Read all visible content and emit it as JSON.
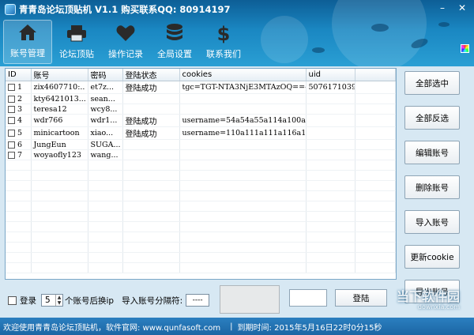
{
  "window": {
    "title": "青青岛论坛顶贴机  V1.1  购买联系QQ: 80914197"
  },
  "toolbar": {
    "items": [
      {
        "label": "账号管理",
        "icon": "home-icon",
        "active": true
      },
      {
        "label": "论坛顶贴",
        "icon": "printer-icon",
        "active": false
      },
      {
        "label": "操作记录",
        "icon": "heart-icon",
        "active": false
      },
      {
        "label": "全局设置",
        "icon": "database-icon",
        "active": false
      },
      {
        "label": "联系我们",
        "icon": "dollar-icon",
        "active": false
      }
    ]
  },
  "grid": {
    "columns": [
      "ID",
      "账号",
      "密码",
      "登陆状态",
      "cookies",
      "uid"
    ],
    "rows": [
      {
        "id": "1",
        "account": "zix4607710:..",
        "password": "et7z...",
        "status": "登陆成功",
        "cookies": "tgc=TGT-NTA3NjE3MTAzOQ==-140...",
        "uid": "5076171039"
      },
      {
        "id": "2",
        "account": "kty6421013...",
        "password": "sean...",
        "status": "",
        "cookies": "",
        "uid": ""
      },
      {
        "id": "3",
        "account": "teresa12",
        "password": "wcy8...",
        "status": "",
        "cookies": "",
        "uid": ""
      },
      {
        "id": "4",
        "account": "wdr766",
        "password": "wdr1...",
        "status": "登陆成功",
        "cookies": "username=54a54a55a114a100a11...",
        "uid": ""
      },
      {
        "id": "5",
        "account": "minicartoon",
        "password": "xiao...",
        "status": "登陆成功",
        "cookies": "username=110a111a111a116a114...",
        "uid": ""
      },
      {
        "id": "6",
        "account": "JungEun",
        "password": "SUGA...",
        "status": "",
        "cookies": "",
        "uid": ""
      },
      {
        "id": "7",
        "account": "woyaofly123",
        "password": "wang...",
        "status": "",
        "cookies": "",
        "uid": ""
      }
    ]
  },
  "side_buttons": [
    "全部选中",
    "全部反选",
    "编辑账号",
    "删除账号",
    "导入账号",
    "更新cookie",
    "导出账号"
  ],
  "bottom": {
    "login_label": "登录",
    "count_value": "5",
    "switch_label": "个账号后换ip",
    "sep_label": "导入账号分隔符:",
    "sep_value": "----",
    "login_button": "登陆"
  },
  "statusbar": {
    "welcome": "欢迎使用青青岛论坛顶贴机，软件官网: www.qunfasoft.com",
    "expire": "到期时间: 2015年5月16日22时0分15秒"
  },
  "watermark": {
    "main": "当下软件园",
    "sub": "downxia.com"
  }
}
